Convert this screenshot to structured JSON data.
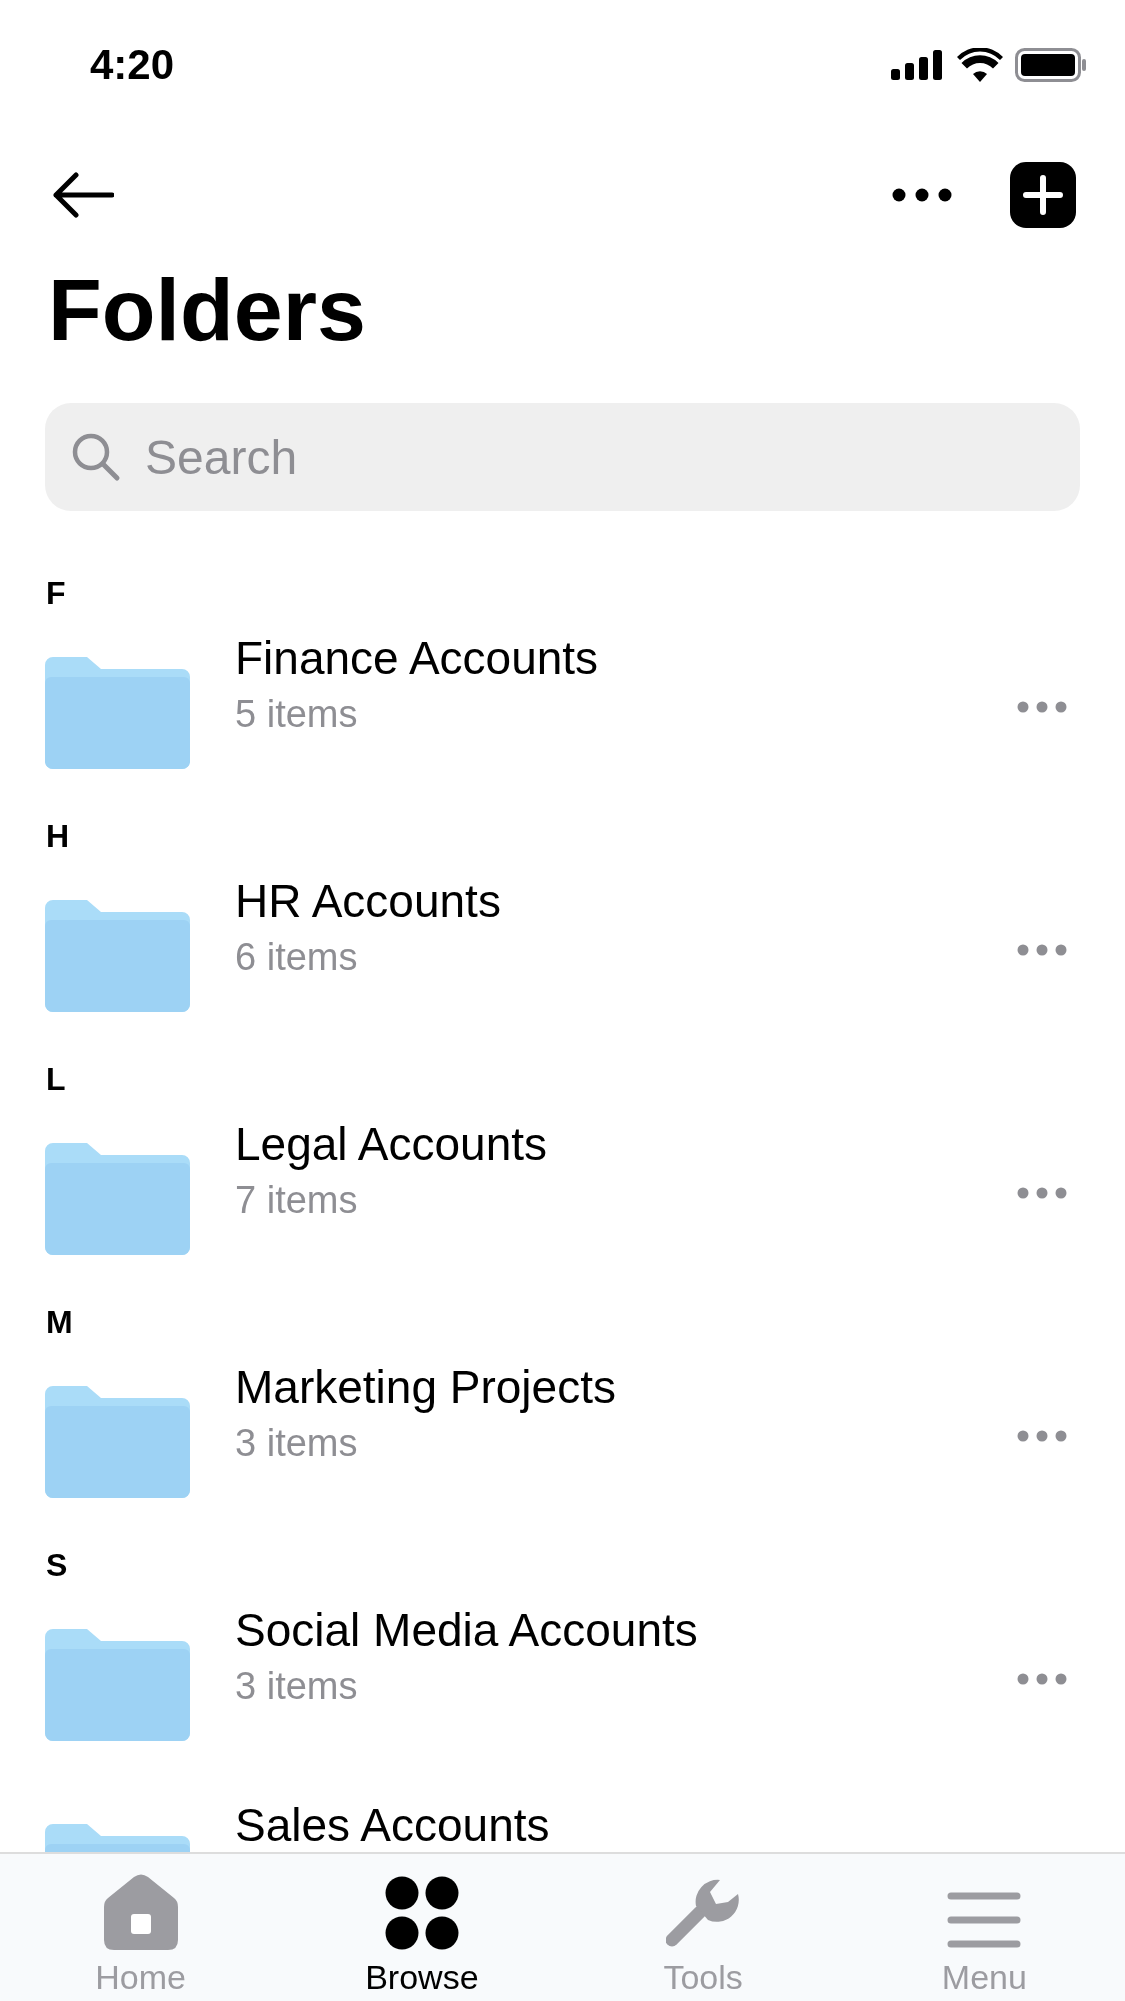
{
  "status_bar": {
    "time": "4:20"
  },
  "title": "Folders",
  "search": {
    "placeholder": "Search"
  },
  "sections": [
    {
      "letter": "F",
      "folders": [
        {
          "name": "Finance Accounts",
          "count": "5 items"
        }
      ]
    },
    {
      "letter": "H",
      "folders": [
        {
          "name": "HR Accounts",
          "count": "6 items"
        }
      ]
    },
    {
      "letter": "L",
      "folders": [
        {
          "name": "Legal Accounts",
          "count": "7 items"
        }
      ]
    },
    {
      "letter": "M",
      "folders": [
        {
          "name": "Marketing Projects",
          "count": "3 items"
        }
      ]
    },
    {
      "letter": "S",
      "folders": [
        {
          "name": "Social Media Accounts",
          "count": "3 items"
        },
        {
          "name": "Sales Accounts"
        }
      ]
    }
  ],
  "tab_bar": [
    {
      "kind": "home",
      "label": "Home",
      "selected": false
    },
    {
      "kind": "browse",
      "label": "Browse",
      "selected": true
    },
    {
      "kind": "tools",
      "label": "Tools",
      "selected": false
    },
    {
      "kind": "menu",
      "label": "Menu",
      "selected": false
    }
  ]
}
